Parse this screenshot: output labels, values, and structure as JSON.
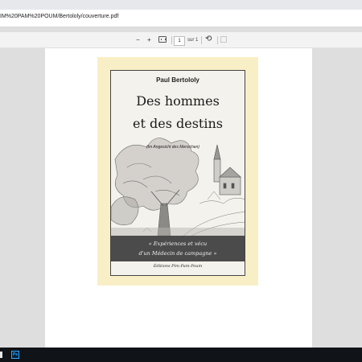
{
  "browser": {
    "address": "IM%20PAM%20POUM/Bertololy/couverture.pdf"
  },
  "pdf_toolbar": {
    "zoom_out": "−",
    "zoom_in": "+",
    "page_current": "1",
    "page_total": "sur 1",
    "rotate": "⟲"
  },
  "cover": {
    "author": "Paul Bertololy",
    "title_line1": "Des hommes",
    "title_line2": "et des destins",
    "subtitle": "(Im Angesicht des Menschen)",
    "banner_line1": "« Expériences et vécu",
    "banner_line2": "d'un Médecin de campagne »",
    "publisher": "Éditions Pim-Pam-Poum"
  },
  "taskbar": {
    "ps_label": "Ps"
  }
}
